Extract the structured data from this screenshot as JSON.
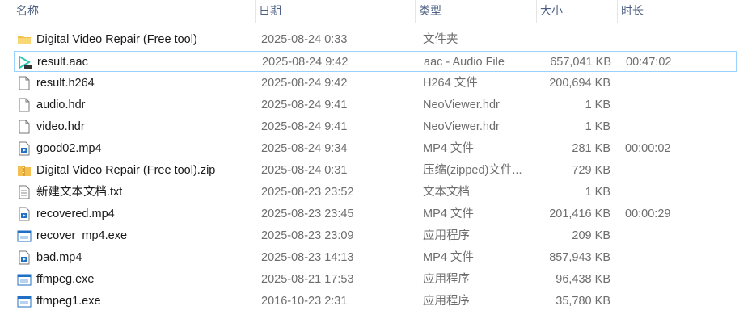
{
  "columns": [
    {
      "label": "名称"
    },
    {
      "label": "日期"
    },
    {
      "label": "类型"
    },
    {
      "label": "大小"
    },
    {
      "label": "时长"
    }
  ],
  "files": [
    {
      "name": "Digital Video Repair (Free tool)",
      "date": "2025-08-24 0:33",
      "type": "文件夹",
      "size": "",
      "duration": "",
      "icon": "folder-icon"
    },
    {
      "name": "result.aac",
      "date": "2025-08-24 9:42",
      "type": "aac - Audio File",
      "size": "657,041 KB",
      "duration": "00:47:02",
      "icon": "audio-file-icon",
      "selected": true
    },
    {
      "name": "result.h264",
      "date": "2025-08-24 9:42",
      "type": "H264 文件",
      "size": "200,694 KB",
      "duration": "",
      "icon": "document-icon"
    },
    {
      "name": "audio.hdr",
      "date": "2025-08-24 9:41",
      "type": "NeoViewer.hdr",
      "size": "1 KB",
      "duration": "",
      "icon": "document-icon"
    },
    {
      "name": "video.hdr",
      "date": "2025-08-24 9:41",
      "type": "NeoViewer.hdr",
      "size": "1 KB",
      "duration": "",
      "icon": "document-icon"
    },
    {
      "name": "good02.mp4",
      "date": "2025-08-24 9:34",
      "type": "MP4 文件",
      "size": "281 KB",
      "duration": "00:00:02",
      "icon": "video-file-icon"
    },
    {
      "name": "Digital Video Repair (Free tool).zip",
      "date": "2025-08-24 0:31",
      "type": "压缩(zipped)文件...",
      "size": "729 KB",
      "duration": "",
      "icon": "zip-folder-icon"
    },
    {
      "name": "新建文本文档.txt",
      "date": "2025-08-23 23:52",
      "type": "文本文档",
      "size": "1 KB",
      "duration": "",
      "icon": "text-file-icon"
    },
    {
      "name": "recovered.mp4",
      "date": "2025-08-23 23:45",
      "type": "MP4 文件",
      "size": "201,416 KB",
      "duration": "00:00:29",
      "icon": "video-file-icon"
    },
    {
      "name": "recover_mp4.exe",
      "date": "2025-08-23 23:09",
      "type": "应用程序",
      "size": "209 KB",
      "duration": "",
      "icon": "application-icon"
    },
    {
      "name": "bad.mp4",
      "date": "2025-08-23 14:13",
      "type": "MP4 文件",
      "size": "857,943 KB",
      "duration": "",
      "icon": "video-file-icon"
    },
    {
      "name": "ffmpeg.exe",
      "date": "2025-08-21 17:53",
      "type": "应用程序",
      "size": "96,438 KB",
      "duration": "",
      "icon": "application-icon"
    },
    {
      "name": "ffmpeg1.exe",
      "date": "2016-10-23 2:31",
      "type": "应用程序",
      "size": "35,780 KB",
      "duration": "",
      "icon": "application-icon"
    }
  ],
  "colors": {
    "header_text": "#4d6082",
    "selection_border": "#99d1ff",
    "folder": "#f3c04f",
    "file_blue": "#1f6fc5"
  }
}
